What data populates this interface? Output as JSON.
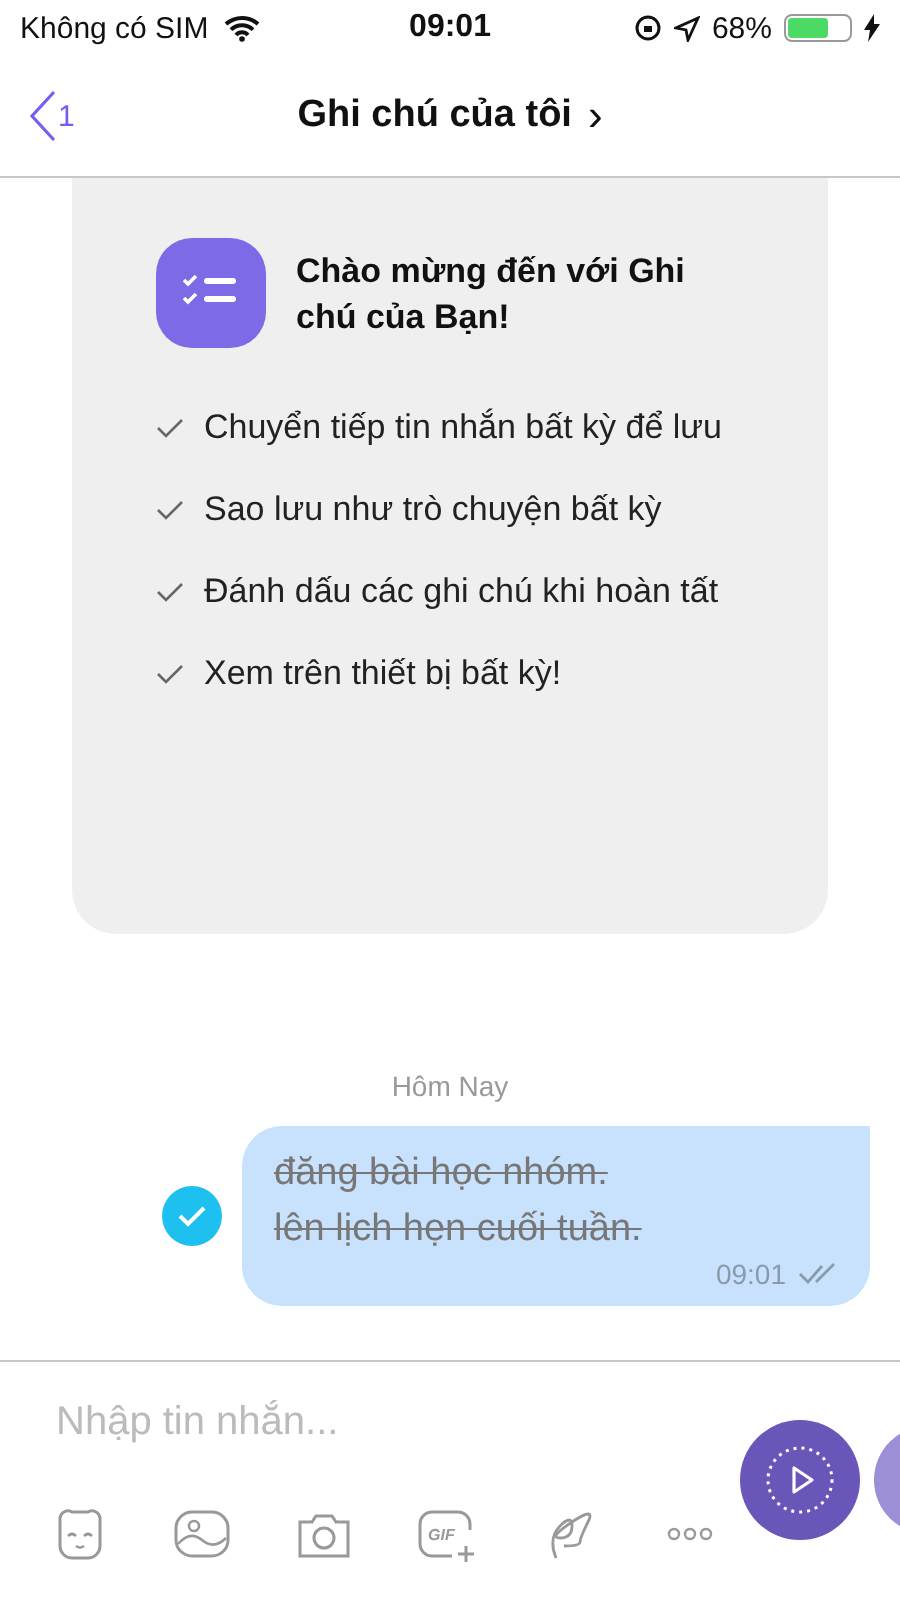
{
  "status_bar": {
    "carrier": "Không có SIM",
    "time": "09:01",
    "battery_percent": "68%",
    "battery": {
      "level": 0.68
    }
  },
  "nav": {
    "back_count": "1",
    "title": "Ghi chú của tôi",
    "chevron": "›"
  },
  "welcome_card": {
    "title": "Chào mừng đến với Ghi chú của Bạn!",
    "features": [
      {
        "text": "Chuyển tiếp tin nhắn bất kỳ để lưu"
      },
      {
        "text": "Sao lưu như trò chuyện bất kỳ"
      },
      {
        "text": "Đánh dấu các ghi chú khi hoàn tất"
      },
      {
        "text": "Xem trên thiết bị bất kỳ!"
      }
    ]
  },
  "date_separator": "Hôm Nay",
  "messages": [
    {
      "lines": [
        "đăng bài học nhóm.",
        "lên lịch hẹn cuối tuần."
      ],
      "time": "09:01",
      "checked": true,
      "selected": true
    }
  ],
  "composer": {
    "placeholder": "Nhập tin nhắn...",
    "gif_label": "GIF"
  }
}
